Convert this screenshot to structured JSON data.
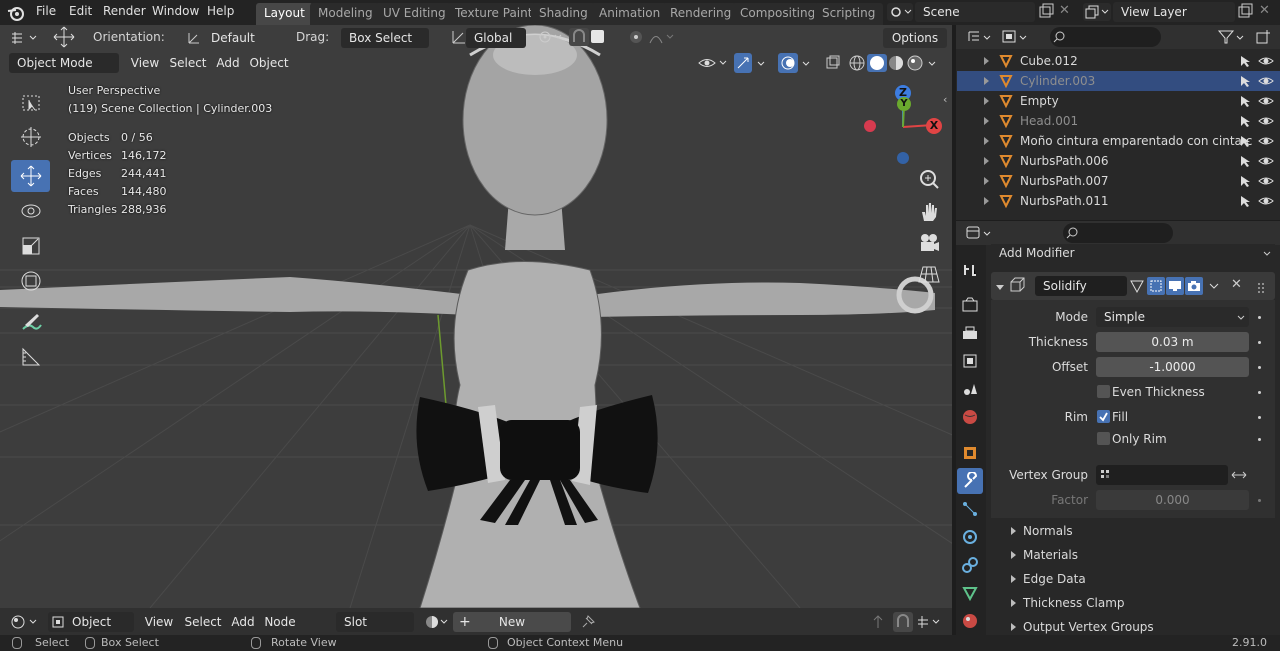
{
  "menus": [
    "File",
    "Edit",
    "Render",
    "Window",
    "Help"
  ],
  "workspaces": [
    "Layout",
    "Modeling",
    "UV Editing",
    "Texture Paint",
    "Shading",
    "Animation",
    "Rendering",
    "Compositing",
    "Scripting"
  ],
  "active_workspace": "Layout",
  "scene": "Scene",
  "view_layer": "View Layer",
  "tool_header": {
    "orientation_label": "Orientation:",
    "orientation_value": "Default",
    "drag_label": "Drag:",
    "drag_value": "Box Select",
    "transform_orientation": "Global",
    "options": "Options"
  },
  "viewport_header": {
    "mode": "Object Mode",
    "view": "View",
    "select": "Select",
    "add": "Add",
    "object": "Object"
  },
  "viewport": {
    "perspective": "User Perspective",
    "collection": "(119) Scene Collection | Cylinder.003",
    "stats": [
      {
        "label": "Objects",
        "value": "0 / 56"
      },
      {
        "label": "Vertices",
        "value": "146,172"
      },
      {
        "label": "Edges",
        "value": "244,441"
      },
      {
        "label": "Faces",
        "value": "144,480"
      },
      {
        "label": "Triangles",
        "value": "288,936"
      }
    ],
    "gizmo": {
      "z": "Z",
      "x": "X",
      "y": "Y"
    }
  },
  "outliner": [
    {
      "name": "Cube.012",
      "selected": false,
      "dim": false
    },
    {
      "name": "Cylinder.003",
      "selected": true,
      "dim": true
    },
    {
      "name": "Empty",
      "selected": false,
      "dim": false
    },
    {
      "name": "Head.001",
      "selected": false,
      "dim": true
    },
    {
      "name": "Moño cintura emparentado con cinta c",
      "selected": false,
      "dim": false
    },
    {
      "name": "NurbsPath.006",
      "selected": false,
      "dim": false
    },
    {
      "name": "NurbsPath.007",
      "selected": false,
      "dim": false
    },
    {
      "name": "NurbsPath.011",
      "selected": false,
      "dim": false
    }
  ],
  "properties": {
    "add_modifier": "Add Modifier",
    "modifier_name": "Solidify",
    "mode_label": "Mode",
    "mode_value": "Simple",
    "thickness_label": "Thickness",
    "thickness_value": "0.03 m",
    "offset_label": "Offset",
    "offset_value": "-1.0000",
    "even_thickness": "Even Thickness",
    "rim_label": "Rim",
    "fill": "Fill",
    "only_rim": "Only Rim",
    "vertex_group_label": "Vertex Group",
    "factor_label": "Factor",
    "factor_value": "0.000",
    "subpanels": [
      "Normals",
      "Materials",
      "Edge Data",
      "Thickness Clamp",
      "Output Vertex Groups"
    ]
  },
  "shader_header": {
    "object": "Object",
    "view": "View",
    "select": "Select",
    "add": "Add",
    "node": "Node",
    "slot": "Slot",
    "new": "New"
  },
  "statusbar": {
    "select": "Select",
    "box_select": "Box Select",
    "rotate_view": "Rotate View",
    "context_menu": "Object Context Menu",
    "version": "2.91.0"
  },
  "colors": {
    "accent": "#4772b3",
    "header": "#303030",
    "viewport_bg": "#3d3d3d"
  }
}
